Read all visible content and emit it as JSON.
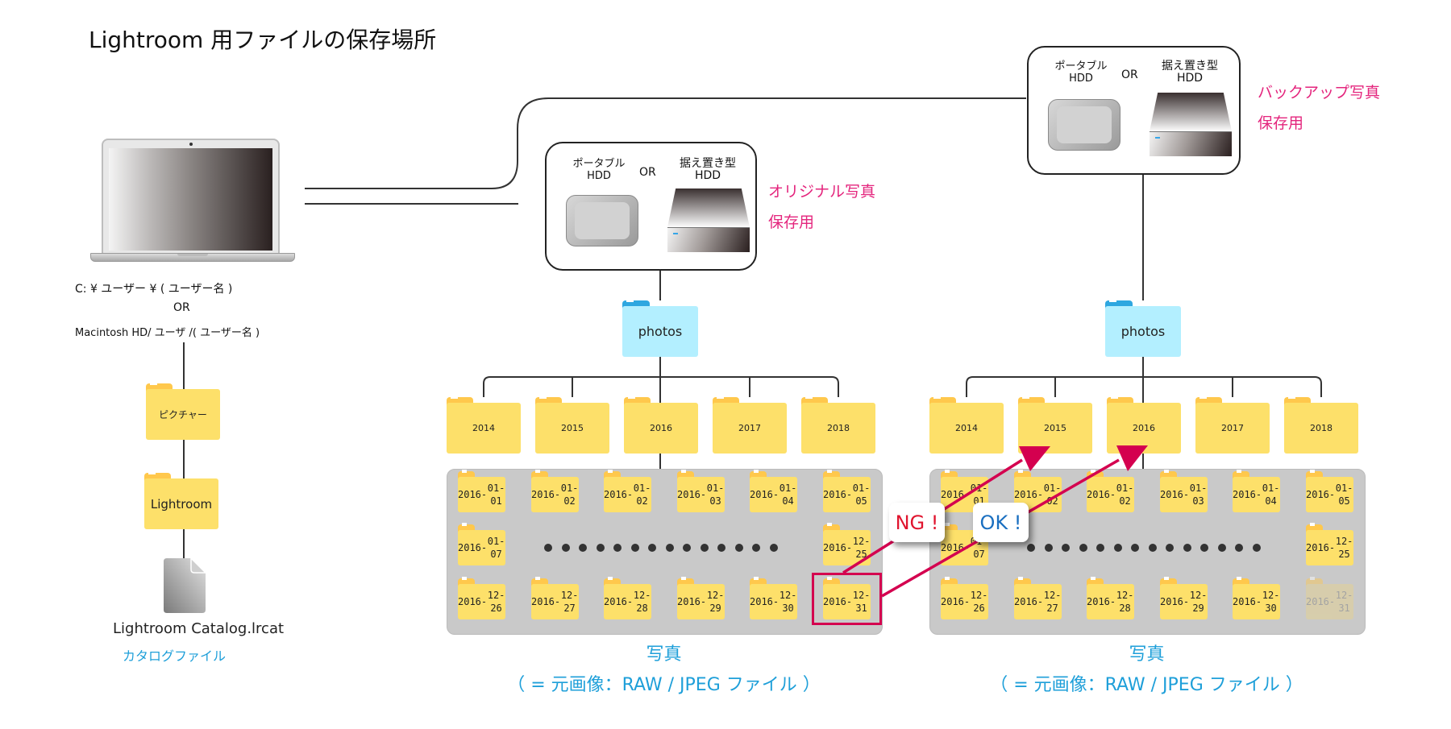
{
  "title": "Lightroom 用ファイルの保存場所",
  "colors": {
    "accent_pink": "#e4257d",
    "caption_blue": "#1e9fd9",
    "folder_yellow": "#fde06a",
    "folder_blue": "#b3efff",
    "arrow_red": "#d4004f",
    "ng_red": "#e0142e",
    "ok_blue": "#1a6fc0",
    "panel_gray": "#c9c9c9"
  },
  "computer": {
    "icon": "laptop-icon",
    "path_windows": "C: ¥ ユーザー ¥ ( ユーザー名 )",
    "or_label": "OR",
    "path_mac": "Macintosh HD/ ユーザ /( ユーザー名 )",
    "folders": [
      "ピクチャー",
      "Lightroom"
    ],
    "catalog_file": "Lightroom Catalog.lrcat",
    "catalog_label": "カタログファイル"
  },
  "storage": [
    {
      "portable_label": "ポータブル",
      "portable_sub": "HDD",
      "or_label": "OR",
      "station_label": "据え置き型",
      "station_sub": "HDD",
      "purpose_line1": "オリジナル写真",
      "purpose_line2": "保存用",
      "root_folder": "photos",
      "year_folders": [
        "2014",
        "2015",
        "2016",
        "2017",
        "2018"
      ],
      "date_rows": [
        [
          "2016-|01-01",
          "2016-|01-02",
          "2016-|01-02",
          "2016-|01-03",
          "2016-|01-04",
          "2016-|01-05"
        ],
        [
          "2016-|01-07",
          "2016-|12-25"
        ],
        [
          "2016-|12-26",
          "2016-|12-27",
          "2016-|12-28",
          "2016-|12-29",
          "2016-|12-30",
          "2016-|12-31"
        ]
      ],
      "ellipsis_dots": 14,
      "caption_line1": "写真",
      "caption_line2": "（ = 元画像：RAW / JPEG ファイル ）"
    },
    {
      "portable_label": "ポータブル",
      "portable_sub": "HDD",
      "or_label": "OR",
      "station_label": "据え置き型",
      "station_sub": "HDD",
      "purpose_line1": "バックアップ写真",
      "purpose_line2": "保存用",
      "root_folder": "photos",
      "year_folders": [
        "2014",
        "2015",
        "2016",
        "2017",
        "2018"
      ],
      "date_rows": [
        [
          "2016-|01-01",
          "2016-|01-02",
          "2016-|01-02",
          "2016-|01-03",
          "2016-|01-04",
          "2016-|01-05"
        ],
        [
          "2016-|01-07",
          "2016-|12-25"
        ],
        [
          "2016-|12-26",
          "2016-|12-27",
          "2016-|12-28",
          "2016-|12-29",
          "2016-|12-30",
          "2016-|12-31"
        ]
      ],
      "faded_folder": "2016-12-31",
      "ellipsis_dots": 14,
      "caption_line1": "写真",
      "caption_line2": "（ = 元画像：RAW / JPEG ファイル ）"
    }
  ],
  "annotations": {
    "highlighted_folder": "2016-12-31",
    "ng_label": "NG !",
    "ng_target": "2015 / 2016-01-02",
    "ok_label": "OK !",
    "ok_target": "2016 / 2016-01-02"
  }
}
